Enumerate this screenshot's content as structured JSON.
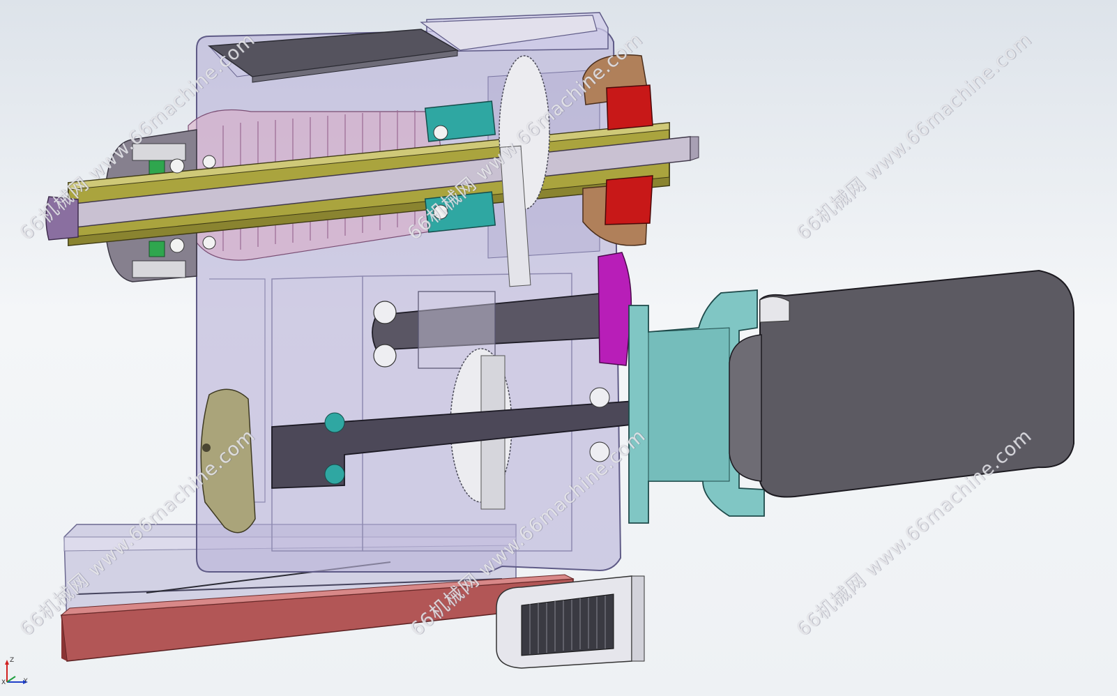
{
  "viewport": {
    "background_top": "#dde3ea",
    "background_bottom": "#eef1f4"
  },
  "watermark": {
    "text": "66机械网 www.66machine.com",
    "copies": 6
  },
  "model": {
    "parts": [
      {
        "name": "gearbox-housing",
        "color": "#b9b2d6"
      },
      {
        "name": "main-hollow-spindle",
        "color": "#a8a23c"
      },
      {
        "name": "drawbar",
        "color": "#c7bfd0"
      },
      {
        "name": "flange-end-cap",
        "color": "#7a5a8a"
      },
      {
        "name": "belleville-spring-stack",
        "color": "#d9a9c4"
      },
      {
        "name": "spur-gear",
        "color": "#e8e8ec"
      },
      {
        "name": "intermediate-shaft",
        "color": "#5a5664"
      },
      {
        "name": "output-shaft",
        "color": "#4c4858"
      },
      {
        "name": "motor-adapter-flange",
        "color": "#7fc6c4"
      },
      {
        "name": "servo-motor-body",
        "color": "#5c5a62"
      },
      {
        "name": "bearing-seal-ring",
        "color": "#2fa7a2"
      },
      {
        "name": "rotary-union-red",
        "color": "#c41a1a"
      },
      {
        "name": "bronze-nut",
        "color": "#a0704a"
      },
      {
        "name": "magenta-cover",
        "color": "#b41ab4"
      },
      {
        "name": "olive-side-cover",
        "color": "#a8a278"
      },
      {
        "name": "base-plate",
        "color": "#b9b8d4"
      },
      {
        "name": "red-guide-rail",
        "color": "#b05050"
      },
      {
        "name": "threaded-sleeve",
        "color": "#3a3a42"
      }
    ]
  },
  "triad": {
    "x_label": "X",
    "y_label": "Y",
    "z_label": "Z"
  }
}
